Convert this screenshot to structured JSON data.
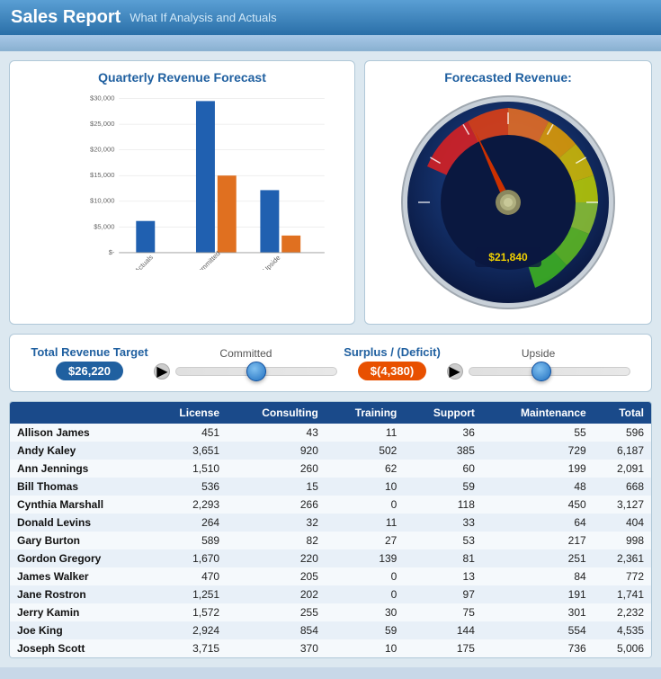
{
  "header": {
    "title": "Sales Report",
    "subtitle": "What If Analysis and Actuals"
  },
  "bar_chart": {
    "title": "Quarterly Revenue Forecast",
    "y_labels": [
      "$30,000",
      "$25,000",
      "$20,000",
      "$15,000",
      "$10,000",
      "$5,000",
      "$-"
    ],
    "groups": [
      {
        "label": "Actuals",
        "bars": [
          {
            "color": "#2060b0",
            "value": 5500,
            "max": 30000
          },
          {
            "color": "#e07020",
            "value": 0,
            "max": 30000
          }
        ]
      },
      {
        "label": "Committed",
        "bars": [
          {
            "color": "#2060b0",
            "value": 26500,
            "max": 30000
          },
          {
            "color": "#e07020",
            "value": 13500,
            "max": 30000
          }
        ]
      },
      {
        "label": "Upside",
        "bars": [
          {
            "color": "#2060b0",
            "value": 11000,
            "max": 30000
          },
          {
            "color": "#e07020",
            "value": 3000,
            "max": 30000
          }
        ]
      }
    ]
  },
  "gauge": {
    "title": "Forecasted Revenue:",
    "value": "$21,840",
    "needle_angle": -20
  },
  "targets": {
    "total_revenue_label": "Total Revenue Target",
    "total_revenue_value": "$26,220",
    "surplus_label": "Surplus / (Deficit)",
    "surplus_value": "$(4,380)"
  },
  "sliders": {
    "committed_label": "Committed",
    "committed_thumb_pct": 50,
    "upside_label": "Upside",
    "upside_thumb_pct": 45
  },
  "table": {
    "headers": [
      "",
      "License",
      "Consulting",
      "Training",
      "Support",
      "Maintenance",
      "Total"
    ],
    "rows": [
      [
        "Allison James",
        "451",
        "43",
        "11",
        "36",
        "55",
        "596"
      ],
      [
        "Andy Kaley",
        "3,651",
        "920",
        "502",
        "385",
        "729",
        "6,187"
      ],
      [
        "Ann Jennings",
        "1,510",
        "260",
        "62",
        "60",
        "199",
        "2,091"
      ],
      [
        "Bill Thomas",
        "536",
        "15",
        "10",
        "59",
        "48",
        "668"
      ],
      [
        "Cynthia Marshall",
        "2,293",
        "266",
        "0",
        "118",
        "450",
        "3,127"
      ],
      [
        "Donald Levins",
        "264",
        "32",
        "11",
        "33",
        "64",
        "404"
      ],
      [
        "Gary Burton",
        "589",
        "82",
        "27",
        "53",
        "217",
        "998"
      ],
      [
        "Gordon Gregory",
        "1,670",
        "220",
        "139",
        "81",
        "251",
        "2,361"
      ],
      [
        "James Walker",
        "470",
        "205",
        "0",
        "13",
        "84",
        "772"
      ],
      [
        "Jane Rostron",
        "1,251",
        "202",
        "0",
        "97",
        "191",
        "1,741"
      ],
      [
        "Jerry Kamin",
        "1,572",
        "255",
        "30",
        "75",
        "301",
        "2,232"
      ],
      [
        "Joe King",
        "2,924",
        "854",
        "59",
        "144",
        "554",
        "4,535"
      ],
      [
        "Joseph Scott",
        "3,715",
        "370",
        "10",
        "175",
        "736",
        "5,006"
      ]
    ]
  }
}
